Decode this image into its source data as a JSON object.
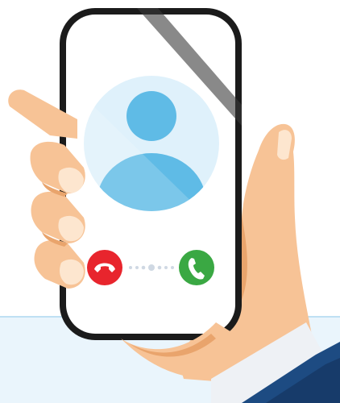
{
  "image_kind": "incoming-call-illustration",
  "colors": {
    "background_top": "#ffffff",
    "background_bottom": "#eaf5fc",
    "horizon_line": "#bfe0f3",
    "skin": "#f7c396",
    "skin_shadow": "#e9a46c",
    "nail": "#fde6cf",
    "sleeve": "#1d4b82",
    "sleeve_dark": "#173b6a",
    "cuff": "#eef1f5",
    "phone_frame": "#1b1b1b",
    "phone_screen": "#ffffff",
    "avatar_circle": "#dff1fb",
    "avatar_figure": "#5fbbe6",
    "decline_button": "#e8252d",
    "accept_button": "#3aa843",
    "swipe_dots": "#cfd8e3"
  },
  "phone": {
    "screen_state": "incoming-call",
    "avatar_icon": "user-silhouette-icon",
    "decline_icon": "phone-hang-up-icon",
    "accept_icon": "phone-handset-icon",
    "swipe_indicator_icon": "dots-track-icon"
  }
}
